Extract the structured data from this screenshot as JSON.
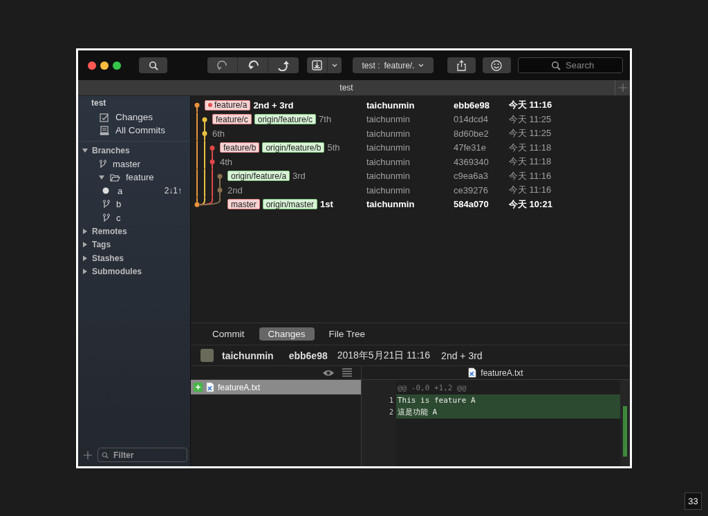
{
  "toolbar": {
    "branch_selector": {
      "repo": "test :",
      "branch": "feature/."
    },
    "search": {
      "placeholder": "Search"
    }
  },
  "tab_title": "test",
  "sidebar": {
    "repo": "test",
    "items": [
      {
        "label": "Changes",
        "kind": "changes"
      },
      {
        "label": "All Commits",
        "kind": "commits"
      }
    ],
    "sections": [
      {
        "label": "Branches",
        "expanded": true,
        "children": [
          {
            "label": "master",
            "kind": "branch"
          },
          {
            "label": "feature",
            "kind": "folder",
            "expanded": true,
            "children": [
              {
                "label": "a",
                "kind": "current",
                "badge": "2↓1↑"
              },
              {
                "label": "b",
                "kind": "branch"
              },
              {
                "label": "c",
                "kind": "branch"
              }
            ]
          }
        ]
      },
      {
        "label": "Remotes",
        "expanded": false
      },
      {
        "label": "Tags",
        "expanded": false
      },
      {
        "label": "Stashes",
        "expanded": false
      },
      {
        "label": "Submodules",
        "expanded": false
      }
    ],
    "filter": {
      "placeholder": "Filter"
    }
  },
  "commits": [
    {
      "refs": [
        {
          "text": "feature/a",
          "kind": "local",
          "head": true
        }
      ],
      "message": "2nd + 3rd",
      "author": "taichunmin",
      "hash": "ebb6e98",
      "date": "今天 11:16",
      "highlighted": true,
      "color": "#e8943a"
    },
    {
      "refs": [
        {
          "text": "feature/c",
          "kind": "local",
          "head": false
        },
        {
          "text": "origin/feature/c",
          "kind": "remote",
          "head": false
        }
      ],
      "message": "7th",
      "author": "taichunmin",
      "hash": "014dcd4",
      "date": "今天 11:25",
      "highlighted": false,
      "color": "#e8c040"
    },
    {
      "message": "6th",
      "author": "taichunmin",
      "hash": "8d60be2",
      "date": "今天 11:25",
      "highlighted": false,
      "color": "#e8c040"
    },
    {
      "refs": [
        {
          "text": "feature/b",
          "kind": "local",
          "head": false
        },
        {
          "text": "origin/feature/b",
          "kind": "remote",
          "head": false
        }
      ],
      "message": "5th",
      "author": "taichunmin",
      "hash": "47fe31e",
      "date": "今天 11:18",
      "highlighted": false,
      "color": "#e04848"
    },
    {
      "message": "4th",
      "author": "taichunmin",
      "hash": "4369340",
      "date": "今天 11:18",
      "highlighted": false,
      "color": "#e04848"
    },
    {
      "refs": [
        {
          "text": "origin/feature/a",
          "kind": "remote",
          "head": false
        }
      ],
      "message": "3rd",
      "author": "taichunmin",
      "hash": "c9ea6a3",
      "date": "今天 11:16",
      "highlighted": false,
      "color": "#8a7050"
    },
    {
      "message": "2nd",
      "author": "taichunmin",
      "hash": "ce39276",
      "date": "今天 11:16",
      "highlighted": false,
      "color": "#8a7050"
    },
    {
      "refs": [
        {
          "text": "master",
          "kind": "local",
          "head": false
        },
        {
          "text": "origin/master",
          "kind": "remote",
          "head": false
        }
      ],
      "message": "1st",
      "author": "taichunmin",
      "hash": "584a070",
      "date": "今天 10:21",
      "highlighted": true,
      "color": "#e8943a"
    }
  ],
  "detail_tabs": [
    {
      "label": "Commit",
      "selected": false
    },
    {
      "label": "Changes",
      "selected": true
    },
    {
      "label": "File Tree",
      "selected": false
    }
  ],
  "commit_info": {
    "author": "taichunmin",
    "hash": "ebb6e98",
    "date": "2018年5月21日 11:16",
    "message": "2nd + 3rd"
  },
  "files": [
    {
      "name": "featureA.txt",
      "selected": true
    }
  ],
  "diff": {
    "file": "featureA.txt",
    "lines": [
      {
        "text": "@@ -0,0 +1,2 @@",
        "kind": "hunk"
      },
      {
        "number": "1",
        "text": "This is feature A",
        "kind": "added"
      },
      {
        "number": "2",
        "text": "這是功能 A",
        "kind": "added"
      }
    ]
  },
  "slide_number": "33"
}
